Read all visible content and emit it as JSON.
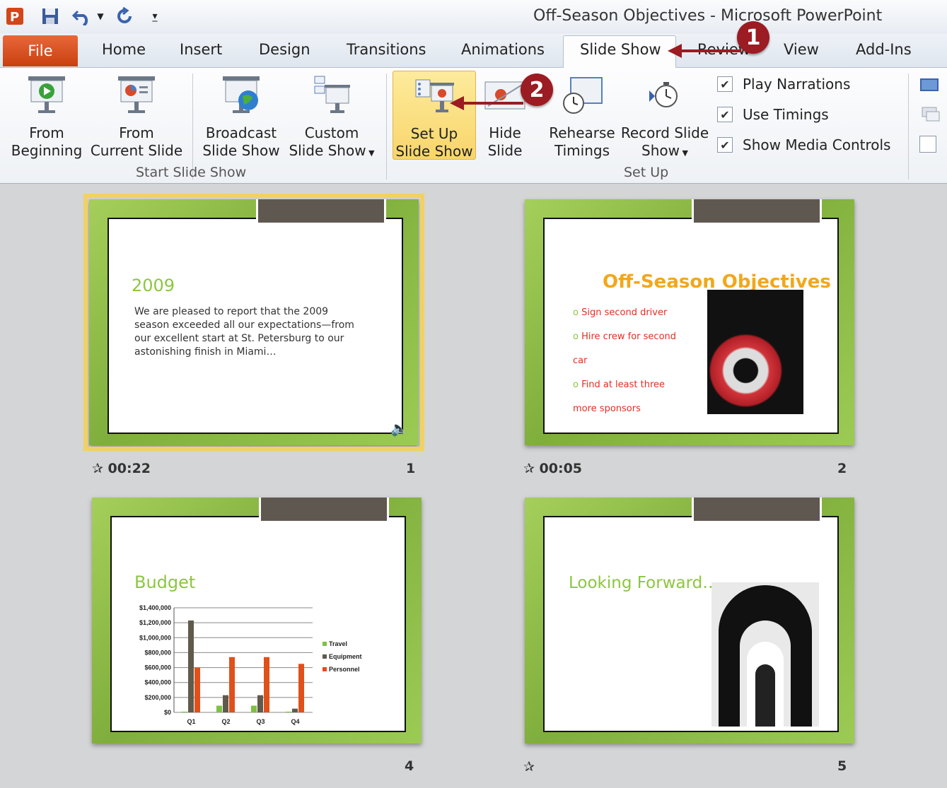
{
  "window": {
    "title": "Off-Season Objectives  -  Microsoft PowerPoint"
  },
  "quick_access": [
    "powerpoint-logo-icon",
    "save-icon",
    "undo-icon",
    "redo-icon",
    "customize-icon"
  ],
  "tabs": {
    "file": "File",
    "items": [
      "Home",
      "Insert",
      "Design",
      "Transitions",
      "Animations",
      "Slide Show",
      "Review",
      "View",
      "Add-Ins"
    ],
    "active": "Slide Show"
  },
  "ribbon": {
    "start_group": {
      "label": "Start Slide Show",
      "from_beginning": [
        "From",
        "Beginning"
      ],
      "from_current": [
        "From",
        "Current Slide"
      ],
      "broadcast": [
        "Broadcast",
        "Slide Show"
      ],
      "custom": [
        "Custom",
        "Slide Show"
      ]
    },
    "setup_group": {
      "label": "Set Up",
      "set_up": [
        "Set Up",
        "Slide Show"
      ],
      "hide": [
        "Hide",
        "Slide"
      ],
      "rehearse": [
        "Rehearse",
        "Timings"
      ],
      "record": [
        "Record Slide",
        "Show"
      ],
      "play_narrations": "Play Narrations",
      "use_timings": "Use Timings",
      "show_media_controls": "Show Media Controls",
      "checks": [
        true,
        true,
        true
      ]
    }
  },
  "callouts": [
    "1",
    "2"
  ],
  "slides": [
    {
      "number": "1",
      "time": "00:22",
      "title": "2009",
      "body": "We are pleased to report  that the 2009 season exceeded all our expectations—from our excellent start at St. Petersburg to our astonishing finish in Miami…"
    },
    {
      "number": "2",
      "time": "00:05",
      "title": "Off-Season Objectives",
      "bullets": [
        "Sign  second driver",
        "Hire crew for second car",
        "Find  at least three more sponsors"
      ]
    },
    {
      "number": "4",
      "time": "",
      "title": "Budget"
    },
    {
      "number": "5",
      "time": "",
      "title": "Looking Forward…"
    }
  ],
  "colors": {
    "accent": "#9b1c22",
    "file_tab": "#d8521f",
    "slide_green": "#8fbf4a",
    "title_green": "#8cc63f",
    "title_orange": "#f2a71b",
    "bullet_red": "#e0301e"
  },
  "chart_data": {
    "type": "bar",
    "categories": [
      "Q1",
      "Q2",
      "Q3",
      "Q4"
    ],
    "series": [
      {
        "name": "Travel",
        "values": [
          10000,
          90000,
          90000,
          10000
        ],
        "color": "#7dc142"
      },
      {
        "name": "Equipment",
        "values": [
          1230000,
          230000,
          230000,
          50000
        ],
        "color": "#605a4d"
      },
      {
        "name": "Personnel",
        "values": [
          600000,
          740000,
          740000,
          650000
        ],
        "color": "#e0501a"
      }
    ],
    "ylim": [
      0,
      1400000
    ],
    "ytick_labels": [
      "$1,400,000",
      "$1,200,000",
      "$1,000,000",
      "$800,000",
      "$600,000",
      "$400,000",
      "$200,000",
      "$0"
    ],
    "legend": "right",
    "grid": true
  }
}
